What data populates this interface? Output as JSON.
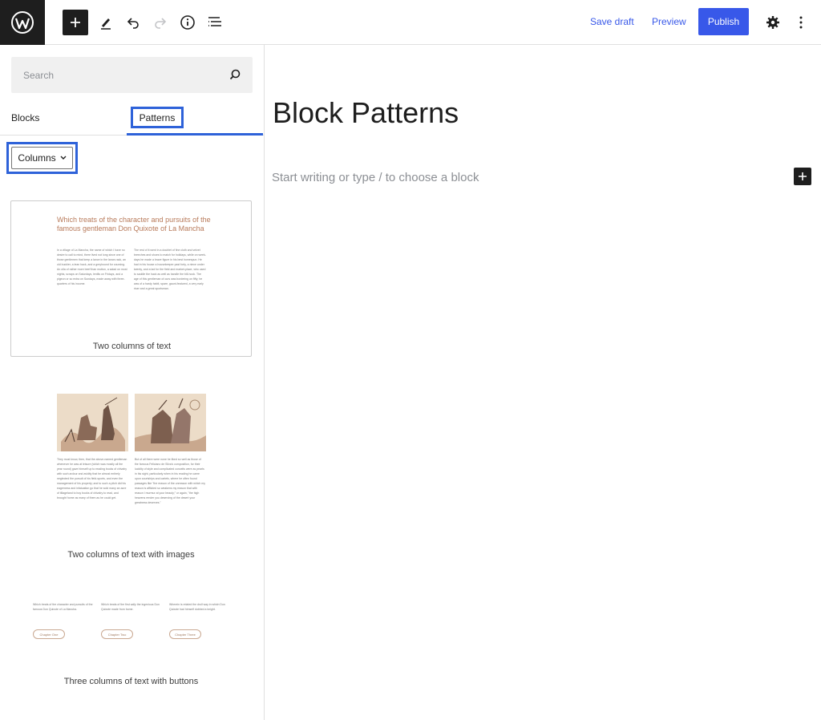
{
  "toolbar": {
    "save_draft": "Save draft",
    "preview": "Preview",
    "publish": "Publish",
    "icons": [
      "wordpress-icon",
      "plus-icon",
      "pencil-icon",
      "undo-icon",
      "redo-icon",
      "info-icon",
      "list-view-icon",
      "gear-icon",
      "more-vertical-icon"
    ]
  },
  "sidebar": {
    "search_placeholder": "Search",
    "tabs": [
      {
        "label": "Blocks"
      },
      {
        "label": "Patterns"
      }
    ],
    "category": "Columns",
    "patterns": [
      {
        "label": "Two columns of text",
        "heading": "Which treats of the character and pursuits of the famous gentleman Don Quixote of La Mancha",
        "col1": "In a village of La Mancha, the name of which I have no desire to call to mind, there lived not long since one of those gentlemen that keep a lance in the lance-rack, an old buckler, a lean hack, and a greyhound for coursing. An olla of rather more beef than mutton, a salad on most nights, scraps on Saturdays, lentils on Fridays, and a pigeon or so extra on Sundays, made away with three-quarters of his income.",
        "col2": "The rest of it went in a doublet of fine cloth and velvet breeches and shoes to match for holidays, while on week-days he made a brave figure in his best homespun. He had in his house a housekeeper past forty, a niece under twenty, and a lad for the field and market-place, who used to saddle the hack as well as handle the bill-hook. The age of this gentleman of ours was bordering on fifty; he was of a hardy habit, spare, gaunt-featured, a very early riser and a great sportsman."
      },
      {
        "label": "Two columns of text with images",
        "col1": "They must know, then, that the above-named gentleman whenever he was at leisure (which was mostly all the year round) gave himself up to reading books of chivalry with such ardour and avidity that he almost entirely neglected the pursuit of his field-sports, and even the management of his property; and to such a pitch did his eagerness and infatuation go that he sold many an acre of tillageland to buy books of chivalry to read, and brought home as many of them as he could get.",
        "col2": "But of all there were none he liked so well as those of the famous Feliciano de Silva's composition, for their lucidity of style and complicated conceits were as pearls in his sight, particularly when in his reading he came upon courtships and cartels, where he often found passages like \"the reason of the unreason with which my reason is afflicted so weakens my reason that with reason I murmur at your beauty;\" or again, \"the high heavens render you deserving of the desert your greatness deserves.\""
      },
      {
        "label": "Three columns of text with buttons",
        "cols": [
          {
            "text": "Which treats of the character and pursuits of the famous Don Quixote of La Mancha.",
            "button": "Chapter One"
          },
          {
            "text": "Which treats of the first sally the ingenious Don Quixote made from home.",
            "button": "Chapter Two"
          },
          {
            "text": "Wherein is related the droll way in which Don Quixote had himself dubbed a knight.",
            "button": "Chapter Three"
          }
        ]
      }
    ]
  },
  "editor": {
    "title": "Block Patterns",
    "placeholder": "Start writing or type / to choose a block"
  },
  "colors": {
    "accent": "#2e62d9",
    "publish": "#3858e9",
    "dark": "#1e1e1e"
  }
}
